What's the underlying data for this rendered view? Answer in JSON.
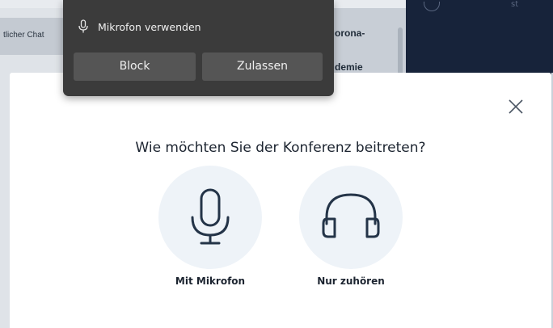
{
  "background": {
    "chat_tab_label": "tlicher Chat",
    "content_line_1": "orona-",
    "content_line_2": "demie",
    "dark_text": "st"
  },
  "permission_prompt": {
    "icon": "microphone-icon",
    "message": "Mikrofon verwenden",
    "block_label": "Block",
    "allow_label": "Zulassen"
  },
  "dialog": {
    "title": "Wie möchten Sie der Konferenz beitreten?",
    "close_icon": "close-icon",
    "options": [
      {
        "icon": "microphone-icon",
        "label": "Mit Mikrofon"
      },
      {
        "icon": "headphones-icon",
        "label": "Nur zuhören"
      }
    ]
  },
  "colors": {
    "option_circle": "#eef3f8",
    "icon_stroke": "#243448",
    "prompt_bg": "#3b3b3b",
    "prompt_button": "#555555"
  }
}
